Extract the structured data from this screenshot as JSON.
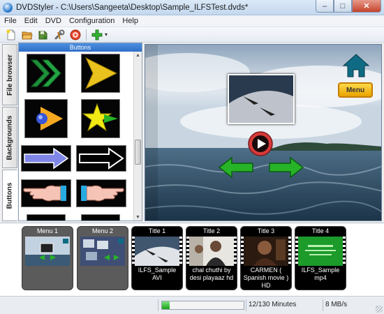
{
  "window": {
    "title": "DVDStyler - C:\\Users\\Sangeeta\\Desktop\\Sample_ILFSTest.dvds*",
    "minimize_glyph": "–",
    "maximize_glyph": "□",
    "close_glyph": "✕"
  },
  "menu": [
    "File",
    "Edit",
    "DVD",
    "Configuration",
    "Help"
  ],
  "toolbar": {
    "icons": [
      "new-icon",
      "open-icon",
      "save-icon",
      "settings-icon",
      "burn-icon",
      "add-icon"
    ],
    "dropdown_glyph": "▾"
  },
  "side_tabs": [
    "File browser",
    "Backgrounds",
    "Buttons"
  ],
  "active_side_tab": "Buttons",
  "panel": {
    "header": "Buttons"
  },
  "button_library": [
    "double-chevron-button",
    "play-triangle-button",
    "ball-arrow-button",
    "star-arrow-button",
    "blue-arrow-button",
    "outline-arrow-button",
    "hand-left-button",
    "hand-right-button"
  ],
  "preview": {
    "menu_button_label": "Menu",
    "icons": [
      "home-icon",
      "play-icon",
      "left-arrow-icon",
      "right-arrow-icon"
    ]
  },
  "titleset": [
    {
      "label": "Menu 1",
      "caption": "",
      "kind": "menu"
    },
    {
      "label": "Menu 2",
      "caption": "",
      "kind": "menu"
    },
    {
      "label": "Title 1",
      "caption": "ILFS_Sample AVI",
      "kind": "title"
    },
    {
      "label": "Title 2",
      "caption": "chal chuthi by desi playaaz hd",
      "kind": "title"
    },
    {
      "label": "Title 3",
      "caption": "CARMEN ( Spanish movie ) HD",
      "kind": "title"
    },
    {
      "label": "Title 4",
      "caption": "ILFS_Sample mp4",
      "kind": "title"
    }
  ],
  "status": {
    "progress_fraction": 0.092,
    "duration": "12/130 Minutes",
    "bitrate": "8 MB/s"
  },
  "colors": {
    "accent": "#2f6ec8",
    "progress": "#17a317",
    "menu_button": "#f5c000",
    "arrow_green": "#27b327",
    "play_red": "#d63a3a"
  }
}
